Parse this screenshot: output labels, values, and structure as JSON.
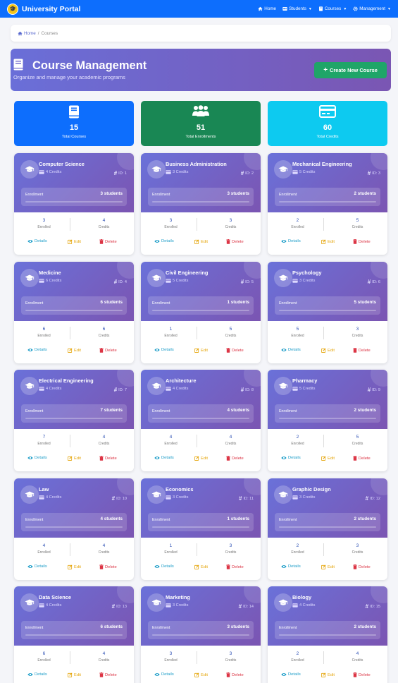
{
  "brand": {
    "name": "University Portal"
  },
  "nav": {
    "home": "Home",
    "students": "Students",
    "courses": "Courses",
    "management": "Management"
  },
  "breadcrumb": {
    "home": "Home",
    "current": "Courses"
  },
  "header": {
    "title": "Course Management",
    "subtitle": "Organize and manage your academic programs",
    "create_label": "Create New Course"
  },
  "stats": [
    {
      "value": "15",
      "label": "Total Courses",
      "icon": "book-icon",
      "color": "#0d6efd"
    },
    {
      "value": "51",
      "label": "Total Enrollments",
      "icon": "users-icon",
      "color": "#198754"
    },
    {
      "value": "60",
      "label": "Total Credits",
      "icon": "credit-card-icon",
      "color": "#0dcaf0"
    }
  ],
  "labels": {
    "enrollment": "Enrollment",
    "enrolled": "Enrolled",
    "credits": "Credits",
    "details": "Details",
    "edit": "Edit",
    "delete": "Delete"
  },
  "courses": [
    {
      "name": "Computer Science",
      "credits_text": "4 Credits",
      "id_text": "ID: 1",
      "students_text": "3 students",
      "enrolled": "3",
      "credits": "4"
    },
    {
      "name": "Business Administration",
      "credits_text": "3 Credits",
      "id_text": "ID: 2",
      "students_text": "3 students",
      "enrolled": "3",
      "credits": "3"
    },
    {
      "name": "Mechanical Engineering",
      "credits_text": "5 Credits",
      "id_text": "ID: 3",
      "students_text": "2 students",
      "enrolled": "2",
      "credits": "5"
    },
    {
      "name": "Medicine",
      "credits_text": "6 Credits",
      "id_text": "ID: 4",
      "students_text": "6 students",
      "enrolled": "6",
      "credits": "6"
    },
    {
      "name": "Civil Engineering",
      "credits_text": "5 Credits",
      "id_text": "ID: 5",
      "students_text": "1 students",
      "enrolled": "1",
      "credits": "5"
    },
    {
      "name": "Psychology",
      "credits_text": "3 Credits",
      "id_text": "ID: 6",
      "students_text": "5 students",
      "enrolled": "5",
      "credits": "3"
    },
    {
      "name": "Electrical Engineering",
      "credits_text": "4 Credits",
      "id_text": "ID: 7",
      "students_text": "7 students",
      "enrolled": "7",
      "credits": "4"
    },
    {
      "name": "Architecture",
      "credits_text": "4 Credits",
      "id_text": "ID: 8",
      "students_text": "4 students",
      "enrolled": "4",
      "credits": "4"
    },
    {
      "name": "Pharmacy",
      "credits_text": "5 Credits",
      "id_text": "ID: 9",
      "students_text": "2 students",
      "enrolled": "2",
      "credits": "5"
    },
    {
      "name": "Law",
      "credits_text": "4 Credits",
      "id_text": "ID: 10",
      "students_text": "4 students",
      "enrolled": "4",
      "credits": "4"
    },
    {
      "name": "Economics",
      "credits_text": "3 Credits",
      "id_text": "ID: 11",
      "students_text": "1 students",
      "enrolled": "1",
      "credits": "3"
    },
    {
      "name": "Graphic Design",
      "credits_text": "3 Credits",
      "id_text": "ID: 12",
      "students_text": "2 students",
      "enrolled": "2",
      "credits": "3"
    },
    {
      "name": "Data Science",
      "credits_text": "4 Credits",
      "id_text": "ID: 13",
      "students_text": "6 students",
      "enrolled": "6",
      "credits": "4"
    },
    {
      "name": "Marketing",
      "credits_text": "3 Credits",
      "id_text": "ID: 14",
      "students_text": "3 students",
      "enrolled": "3",
      "credits": "3"
    },
    {
      "name": "Biology",
      "credits_text": "4 Credits",
      "id_text": "ID: 15",
      "students_text": "2 students",
      "enrolled": "2",
      "credits": "4"
    }
  ]
}
